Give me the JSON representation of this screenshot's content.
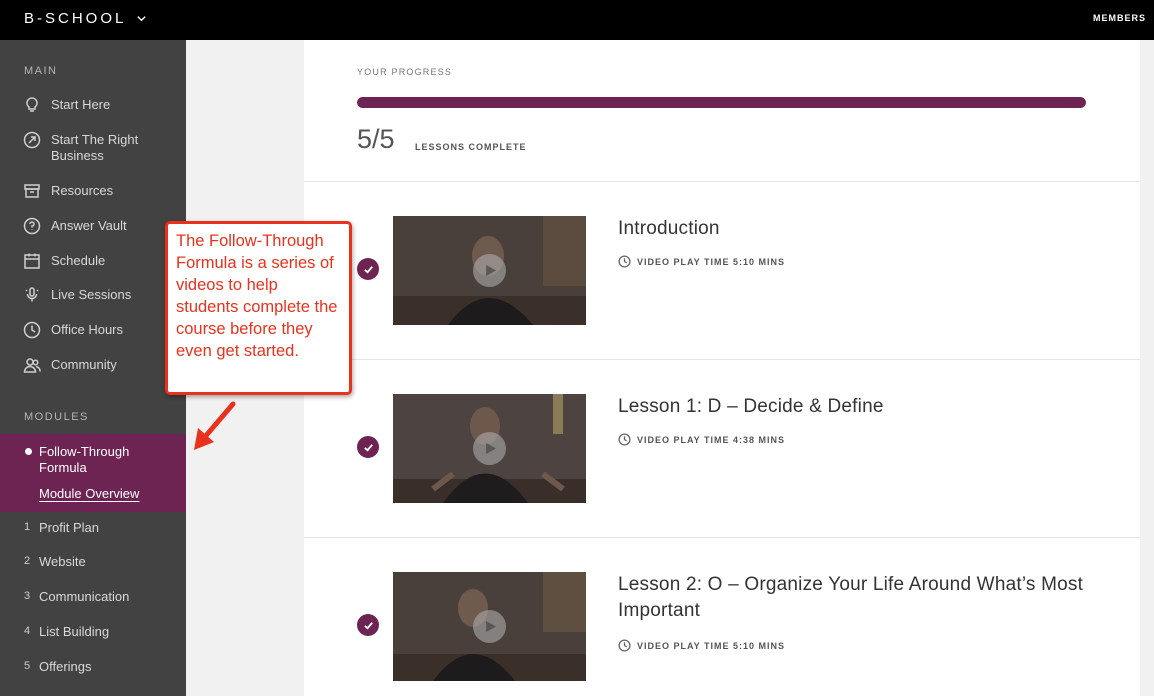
{
  "topbar": {
    "brand": "B-SCHOOL",
    "members": "MEMBERS"
  },
  "sidebar": {
    "main_label": "MAIN",
    "items": [
      {
        "label": "Start Here",
        "icon": "lightbulb-icon"
      },
      {
        "label": "Start The Right Business",
        "icon": "compass-icon"
      },
      {
        "label": "Resources",
        "icon": "archive-box-icon"
      },
      {
        "label": "Answer Vault",
        "icon": "question-circle-icon"
      },
      {
        "label": "Schedule",
        "icon": "calendar-icon"
      },
      {
        "label": "Live Sessions",
        "icon": "microphone-icon"
      },
      {
        "label": "Office Hours",
        "icon": "clock-icon"
      },
      {
        "label": "Community",
        "icon": "people-icon"
      }
    ],
    "modules_label": "MODULES",
    "active_module": {
      "title": "Follow-Through Formula",
      "sub": "Module Overview"
    },
    "modules": [
      {
        "num": "1",
        "label": "Profit Plan"
      },
      {
        "num": "2",
        "label": "Website"
      },
      {
        "num": "3",
        "label": "Communication"
      },
      {
        "num": "4",
        "label": "List Building"
      },
      {
        "num": "5",
        "label": "Offerings"
      }
    ]
  },
  "progress": {
    "label": "YOUR PROGRESS",
    "count": "5/5",
    "text": "LESSONS COMPLETE",
    "fraction": 1.0
  },
  "lessons": [
    {
      "title": "Introduction",
      "meta": "VIDEO PLAY TIME 5:10 MINS"
    },
    {
      "title": "Lesson 1: D – Decide & Define",
      "meta": "VIDEO PLAY TIME 4:38 MINS"
    },
    {
      "title": "Lesson 2: O – Organize Your Life Around What’s Most Important",
      "meta": "VIDEO PLAY TIME 5:10 MINS"
    }
  ],
  "callout": {
    "text": "The Follow-Through Formula is a series of videos to help students complete the course before they even get started."
  },
  "colors": {
    "accent": "#6e2453",
    "annotation": "#e8321d",
    "sidebar": "#424242"
  }
}
